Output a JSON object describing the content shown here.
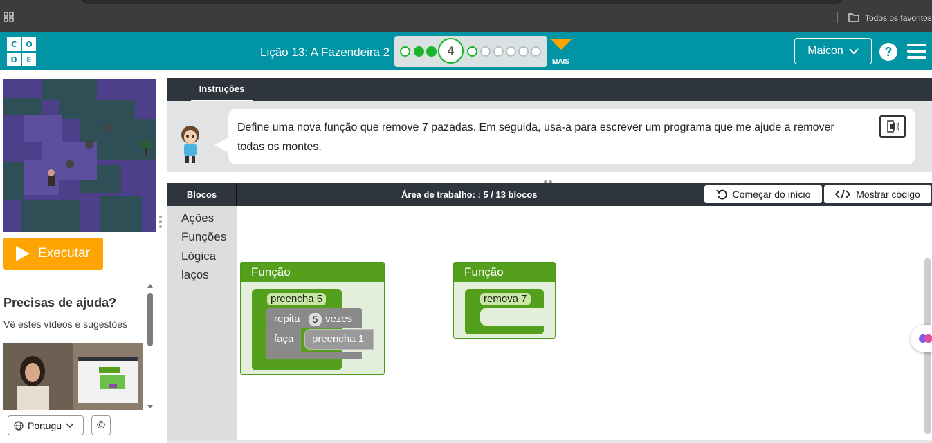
{
  "browser": {
    "favorites_label": "Todos os favoritos"
  },
  "header": {
    "logo_letters": [
      "C",
      "O",
      "D",
      "E"
    ],
    "lesson_title": "Lição 13: A Fazendeira 2",
    "current_level": "4",
    "more_label": "MAIS",
    "user_label": "Maicon",
    "help_label": "?"
  },
  "left": {
    "run_label": "Executar",
    "help_title": "Precisas de ajuda?",
    "help_subtitle": "Vê estes vídeos e sugestões",
    "language_label": "Portugu",
    "copyright_label": "©"
  },
  "instructions": {
    "tab_label": "Instruções",
    "text": "Define uma nova função que remove 7 pazadas. Em seguida, usa-a para escrever um programa que me ajude a remover todas os montes."
  },
  "workspace": {
    "blocks_tab": "Blocos",
    "title": "Área de trabalho: : 5 / 13 blocos",
    "restart_label": "Começar do início",
    "show_code_label": "Mostrar código",
    "toolbox_categories": [
      "Ações",
      "Funções",
      "Lógica",
      "laços"
    ],
    "function_block_1": {
      "header": "Função",
      "name": "preencha 5",
      "repeat_label": "repita",
      "repeat_count": "5",
      "times_label": "vezes",
      "do_label": "faça",
      "inner_call": "preencha 1"
    },
    "function_block_2": {
      "header": "Função",
      "name": "remova 7"
    }
  },
  "colors": {
    "header_bg": "#0094a4",
    "run_button": "#ffa400",
    "block_green": "#54a01c",
    "progress_green": "#19b52b"
  }
}
